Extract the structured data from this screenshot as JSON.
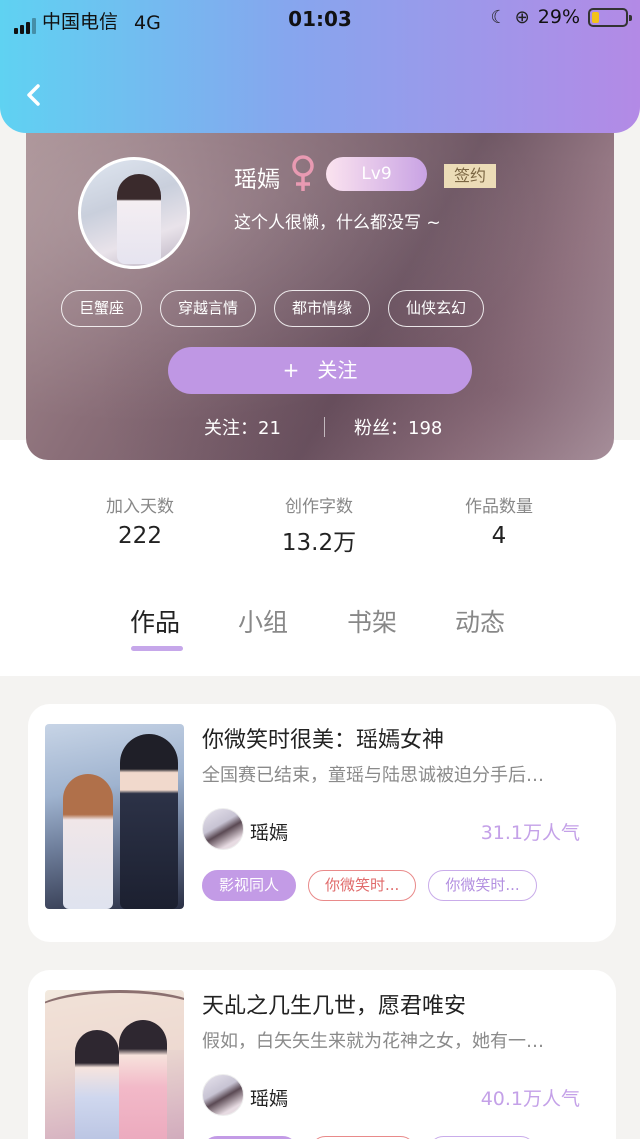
{
  "status_bar": {
    "carrier": "中国电信",
    "network": "4G",
    "time": "01:03",
    "battery": "29%",
    "battery_level": 0.29
  },
  "profile": {
    "name": "瑶嫣",
    "gender_symbol": "♀",
    "level": "Lv9",
    "sign_badge": "签约",
    "bio": "这个人很懒，什么都没写 ~",
    "tags": [
      "巨蟹座",
      "穿越言情",
      "都市情缘",
      "仙侠玄幻"
    ],
    "follow_plus": "+",
    "follow_label": "关注",
    "following": "关注：21",
    "fans": "粉丝：198"
  },
  "stats": [
    {
      "label": "加入天数",
      "value": "222"
    },
    {
      "label": "创作字数",
      "value": "13.2万"
    },
    {
      "label": "作品数量",
      "value": "4"
    }
  ],
  "tabs": [
    "作品",
    "小组",
    "书架",
    "动态"
  ],
  "active_tab": 0,
  "works": [
    {
      "title": "你微笑时很美：瑶嫣女神",
      "desc": "全国赛已结束，童瑶与陆思诚被迫分手后…",
      "author": "瑶嫣",
      "popularity": "31.1万人气",
      "tags": [
        "影视同人",
        "你微笑时...",
        "你微笑时..."
      ]
    },
    {
      "title": "天乩之几生几世，愿君唯安",
      "desc": "假如，白矢矢生来就为花神之女，她有一…",
      "author": "瑶嫣",
      "popularity": "40.1万人气",
      "tags": [
        "",
        "",
        ""
      ]
    }
  ],
  "colors": {
    "accent": "#bf97e4",
    "header_start": "#5fd2f2",
    "header_end": "#b38ae6",
    "popularity": "#c4a1e8"
  }
}
